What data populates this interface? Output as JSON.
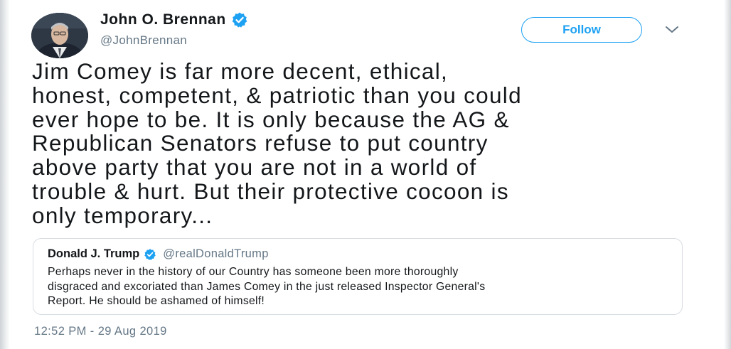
{
  "author": {
    "display_name": "John O. Brennan",
    "handle": "@JohnBrennan",
    "avatar_icon": "portrait-avatar",
    "verified_icon": "verified-badge-icon"
  },
  "actions": {
    "follow_label": "Follow",
    "menu_icon": "chevron-down-icon"
  },
  "tweet": {
    "text": "Jim Comey is far more decent, ethical,\nhonest, competent, & patriotic than you could\never hope to be. It is only because the AG &\nRepublican Senators refuse to put country\nabove party that you are not in a world of\ntrouble & hurt.  But their protective cocoon is\nonly temporary...",
    "timestamp": "12:52 PM - 29 Aug 2019"
  },
  "quoted_tweet": {
    "display_name": "Donald J. Trump",
    "handle": "@realDonaldTrump",
    "text": "Perhaps never in the history of our Country has someone been more thoroughly\ndisgraced and excoriated than James Comey in the just released Inspector General's\nReport. He should be ashamed of himself!"
  },
  "colors": {
    "accent": "#1da1f2",
    "secondary_text": "#657786",
    "primary_text": "#14171a",
    "border": "#d8dde2"
  }
}
